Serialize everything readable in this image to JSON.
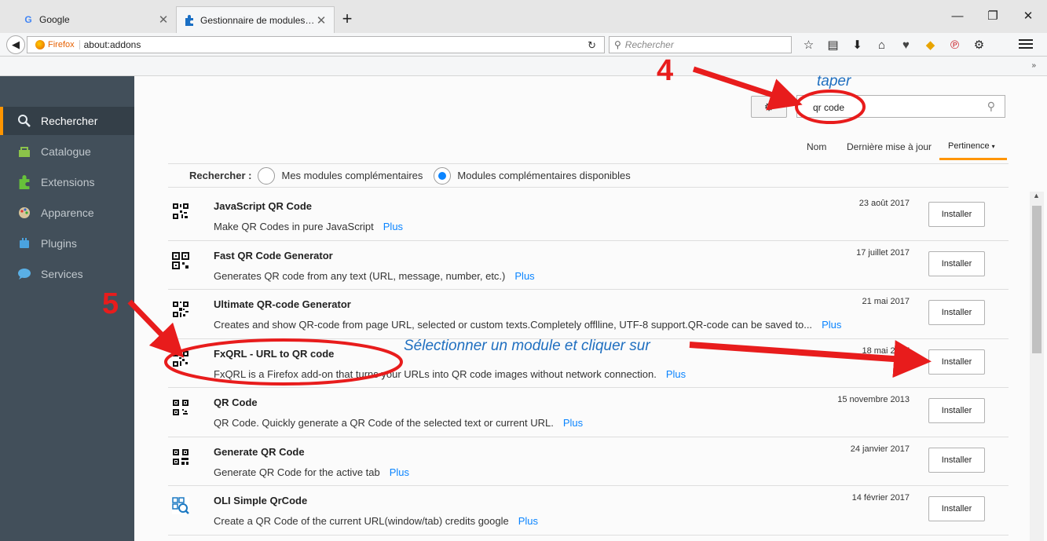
{
  "tabs": [
    {
      "label": "Google",
      "icon": "G"
    },
    {
      "label": "Gestionnaire de modules complémentaires",
      "icon": "puzzle"
    }
  ],
  "nav": {
    "brand": "Firefox",
    "url": "about:addons",
    "search_placeholder": "Rechercher"
  },
  "sidebar": {
    "items": [
      {
        "label": "Rechercher",
        "icon": "search-icon"
      },
      {
        "label": "Catalogue",
        "icon": "catalog-icon"
      },
      {
        "label": "Extensions",
        "icon": "puzzle-icon"
      },
      {
        "label": "Apparence",
        "icon": "palette-icon"
      },
      {
        "label": "Plugins",
        "icon": "plugin-icon"
      },
      {
        "label": "Services",
        "icon": "chat-icon"
      }
    ]
  },
  "search": {
    "value": "qr code"
  },
  "sort": {
    "name": "Nom",
    "updated": "Dernière mise à jour",
    "relevance": "Pertinence"
  },
  "scope": {
    "label": "Rechercher :",
    "mine": "Mes modules complémentaires",
    "available": "Modules complémentaires disponibles"
  },
  "more_label": "Plus",
  "install_label": "Installer",
  "addons": [
    {
      "name": "JavaScript QR Code",
      "desc": "Make QR Codes in pure JavaScript",
      "date": "23 août 2017"
    },
    {
      "name": "Fast QR Code Generator",
      "desc": "Generates QR code from any text (URL, message, number, etc.)",
      "date": "17 juillet 2017"
    },
    {
      "name": "Ultimate QR-code Generator",
      "desc": "Creates and show QR-code from page URL, selected or custom texts.Completely offlline, UTF-8 support.QR-code can be saved to...",
      "date": "21 mai 2017"
    },
    {
      "name": "FxQRL - URL to QR code",
      "desc": "FxQRL is a Firefox add-on that turns your URLs into QR code images without network connection.",
      "date": "18 mai 2017"
    },
    {
      "name": "QR Code",
      "desc": "QR Code. Quickly generate a QR Code of the selected text or current URL.",
      "date": "15 novembre 2013"
    },
    {
      "name": "Generate QR Code",
      "desc": "Generate QR Code for the active tab",
      "date": "24 janvier 2017"
    },
    {
      "name": "OLI Simple QrCode",
      "desc": "Create a QR Code of the current URL(window/tab) credits google",
      "date": "14 février 2017"
    }
  ],
  "annotations": {
    "step4": "4",
    "step4_text": "taper",
    "step5": "5",
    "step5_text": "Sélectionner un module et cliquer sur",
    "color": "#e81c1c"
  }
}
